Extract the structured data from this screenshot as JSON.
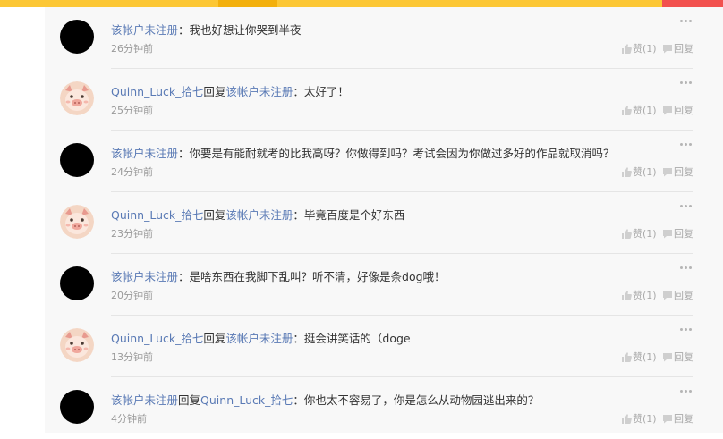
{
  "comments": [
    {
      "avatar": "black-circle",
      "parts": [
        {
          "t": "该帐户未注册",
          "link": true
        },
        {
          "t": "：我也好想让你哭到半夜",
          "link": false
        }
      ],
      "time": "26分钟前",
      "like_label": "赞(1)",
      "reply_label": "回复"
    },
    {
      "avatar": "pig",
      "parts": [
        {
          "t": "Quinn_Luck_拾七",
          "link": true
        },
        {
          "t": "回复",
          "link": false
        },
        {
          "t": "该帐户未注册",
          "link": true
        },
        {
          "t": "：太好了！",
          "link": false
        }
      ],
      "time": "25分钟前",
      "like_label": "赞(1)",
      "reply_label": "回复"
    },
    {
      "avatar": "black-circle",
      "parts": [
        {
          "t": "该帐户未注册",
          "link": true
        },
        {
          "t": "：你要是有能耐就考的比我高呀？你做得到吗？考试会因为你做过多好的作品就取消吗？",
          "link": false
        }
      ],
      "time": "24分钟前",
      "like_label": "赞(1)",
      "reply_label": "回复"
    },
    {
      "avatar": "pig",
      "parts": [
        {
          "t": "Quinn_Luck_拾七",
          "link": true
        },
        {
          "t": "回复",
          "link": false
        },
        {
          "t": "该帐户未注册",
          "link": true
        },
        {
          "t": "：毕竟百度是个好东西",
          "link": false
        }
      ],
      "time": "23分钟前",
      "like_label": "赞(1)",
      "reply_label": "回复"
    },
    {
      "avatar": "black-circle",
      "parts": [
        {
          "t": "该帐户未注册",
          "link": true
        },
        {
          "t": "：是啥东西在我脚下乱叫？听不清，好像是条dog哦！",
          "link": false
        }
      ],
      "time": "20分钟前",
      "like_label": "赞(1)",
      "reply_label": "回复"
    },
    {
      "avatar": "pig",
      "parts": [
        {
          "t": "Quinn_Luck_拾七",
          "link": true
        },
        {
          "t": "回复",
          "link": false
        },
        {
          "t": "该帐户未注册",
          "link": true
        },
        {
          "t": "：挺会讲笑话的（doge",
          "link": false
        }
      ],
      "time": "13分钟前",
      "like_label": "赞(1)",
      "reply_label": "回复"
    },
    {
      "avatar": "black-circle",
      "parts": [
        {
          "t": "该帐户未注册",
          "link": true
        },
        {
          "t": "回复",
          "link": false
        },
        {
          "t": "Quinn_Luck_拾七",
          "link": true
        },
        {
          "t": "：你也太不容易了，你是怎么从动物园逃出来的？",
          "link": false
        }
      ],
      "time": "4分钟前",
      "like_label": "赞(1)",
      "reply_label": "回复"
    }
  ],
  "colors": {
    "top_bar": "#fcc735",
    "top_bar_dark": "#f3b00d",
    "top_bar_red": "#f2514e",
    "username": "#5a7ab5",
    "meta": "#999999"
  },
  "icons": {
    "like": "thumbs-up-icon",
    "reply": "speech-bubble-icon",
    "more": "more-dots-icon"
  }
}
